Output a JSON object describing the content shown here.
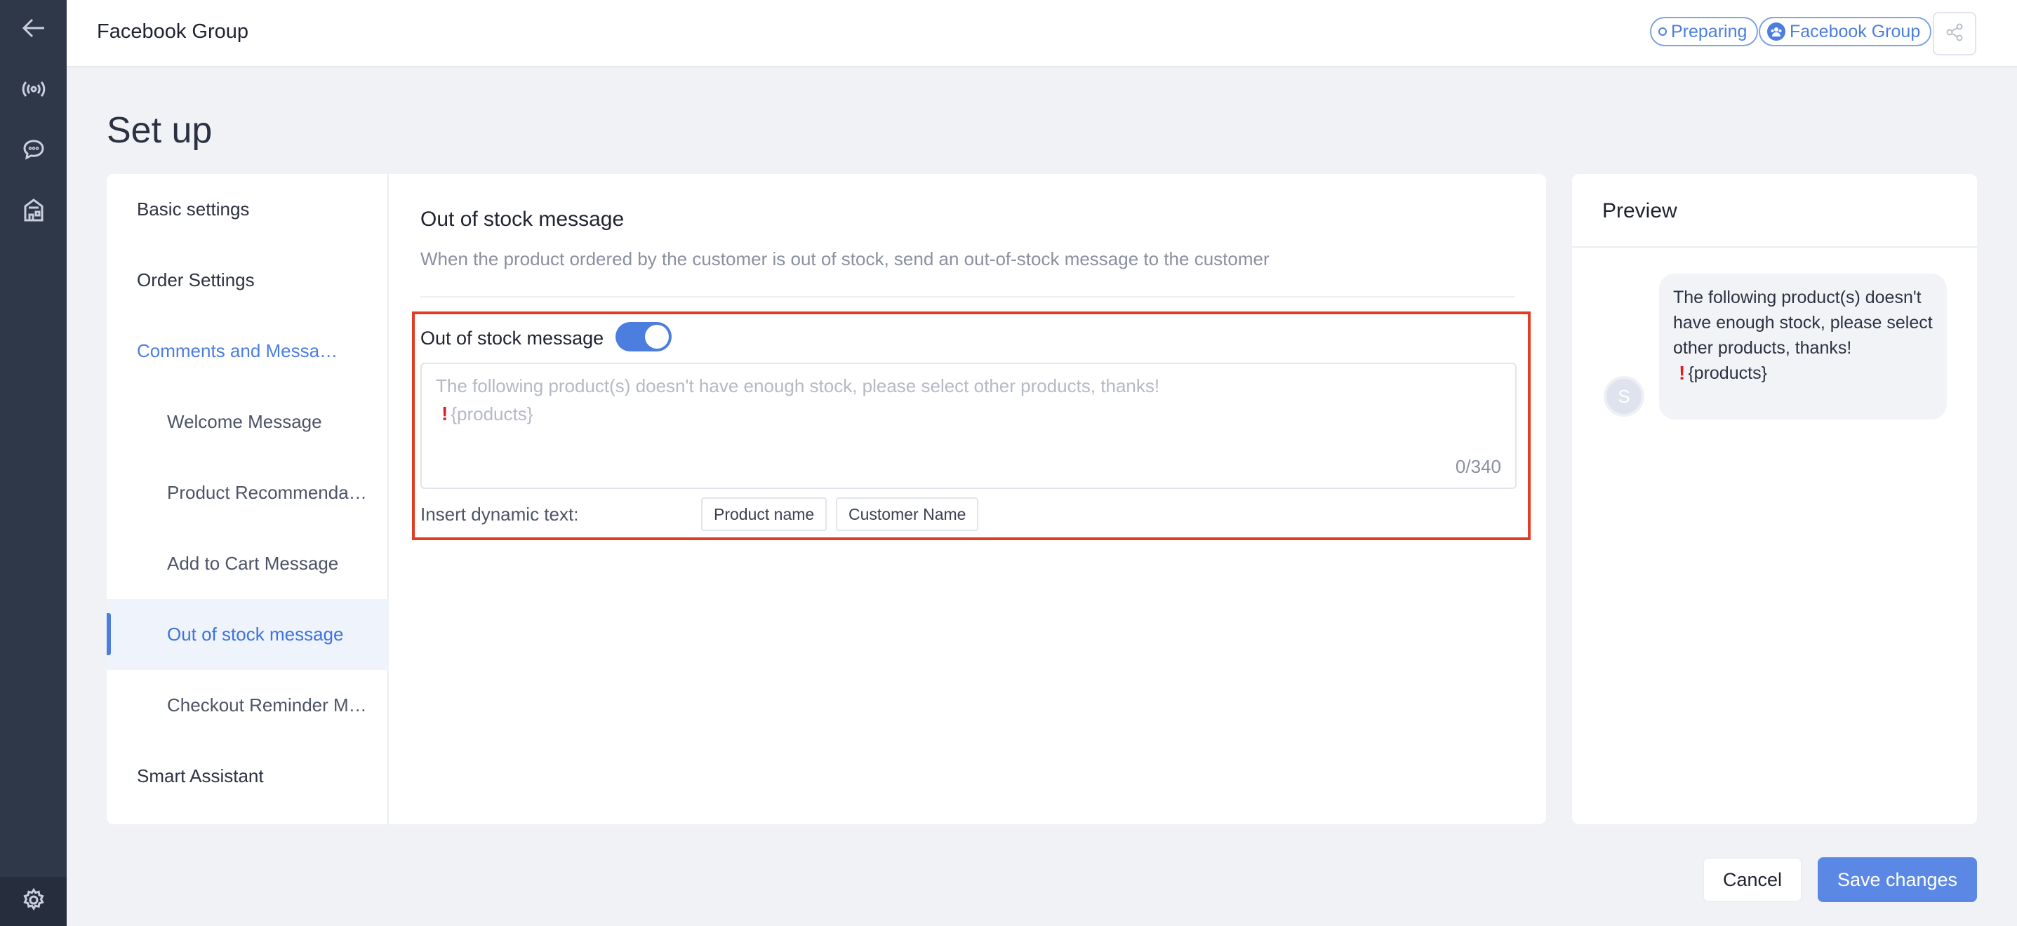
{
  "app": {
    "title": "Facebook Group",
    "status_badge": "Preparing",
    "group_badge": "Facebook Group"
  },
  "rail": {
    "icons": [
      "back-arrow-icon",
      "broadcast-icon",
      "chat-bubble-icon",
      "store-icon",
      "gear-icon"
    ]
  },
  "page": {
    "title": "Set up"
  },
  "menu": {
    "items": [
      {
        "label": "Basic settings"
      },
      {
        "label": "Order Settings"
      },
      {
        "label": "Comments and Messages"
      },
      {
        "label": "Welcome Message"
      },
      {
        "label": "Product Recommendation"
      },
      {
        "label": "Add to Cart Message"
      },
      {
        "label": "Out of stock message"
      },
      {
        "label": "Checkout Reminder Message"
      },
      {
        "label": "Smart Assistant"
      }
    ],
    "selected": "Out of stock message"
  },
  "section": {
    "title": "Out of stock message",
    "description": "When the product ordered by the customer is out of stock, send an out-of-stock message to the customer",
    "toggle_label": "Out of stock message",
    "toggle_on": true,
    "textarea": {
      "placeholder_line1": "The following product(s) doesn't have enough stock, please select other products, thanks!",
      "placeholder_line2": "{products}",
      "counter": "0/340"
    },
    "insert_label": "Insert dynamic text:",
    "chips": [
      "Product name",
      "Customer Name"
    ]
  },
  "preview": {
    "title": "Preview",
    "avatar_letter": "S",
    "message_text": "The following product(s) doesn't have enough stock, please select other products, thanks!",
    "message_token": "{products}"
  },
  "footer": {
    "cancel_label": "Cancel",
    "save_label": "Save changes"
  },
  "colors": {
    "accent": "#4c7ee0",
    "rail_bg": "#2f3849",
    "highlight_border": "#e23c25",
    "save_button": "#5b88e5"
  }
}
